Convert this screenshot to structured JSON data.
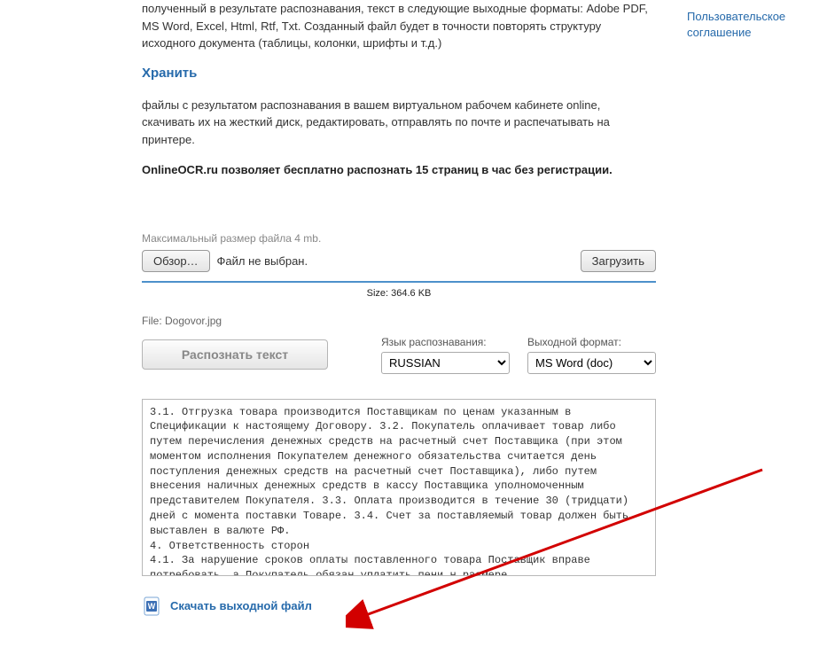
{
  "sidebar": {
    "user_agreement": "Пользовательское соглашение"
  },
  "intro": {
    "convert_text": "полученный в результате распознавания, текст в следующие выходные форматы: Adobe PDF, MS Word, Excel, Html, Rtf, Txt. Созданный файл будет в точности повторять структуру исходного документа (таблицы, колонки, шрифты и т.д.)",
    "store_heading": "Хранить",
    "store_text": "файлы с результатом распознавания в вашем виртуальном рабочем кабинете online, скачивать их на жесткий диск, редактировать, отправлять по почте и распечатывать на принтере.",
    "free_limit": "OnlineOCR.ru позволяет бесплатно распознать 15 страниц в час без регистрации."
  },
  "upload": {
    "max_size": "Максимальный размер файла 4 mb.",
    "browse_btn": "Обзор…",
    "no_file": "Файл не выбран.",
    "upload_btn": "Загрузить",
    "size_line": "Size: 364.6 KB",
    "file_line": "File:  Dogovor.jpg"
  },
  "recognize": {
    "btn": "Распознать текст",
    "lang_label": "Язык распознавания:",
    "lang_value": "RUSSIAN",
    "format_label": "Выходной формат:",
    "format_value": "MS Word (doc)"
  },
  "result_text": "3.1. Отгрузка товара производится Поставщикам по ценам указанным в Спецификации к настоящему Договору. 3.2. Покупатель оплачивает товар либо путем перечисления денежных средств на расчетный счет Поставщика (при этом моментом исполнения Покупателем денежного обязательства считается день поступления денежных средств на расчетный счет Поставщика), либо путем внесения наличных денежных средств в кассу Поставщика уполномоченным представителем Покупателя. 3.3. Оплата производится в течение 30 (тридцати) дней с момента поставки Товаре. 3.4. Счет за поставляемый товар должен быть выставлен в валюте РФ.\n4. Ответственность сторон\n4.1. За нарушение сроков оплаты поставленного товара Поставщик вправе потребовать, а Покупатель обязан уплатить пени н размере",
  "download": {
    "label": "Скачать выходной файл"
  }
}
